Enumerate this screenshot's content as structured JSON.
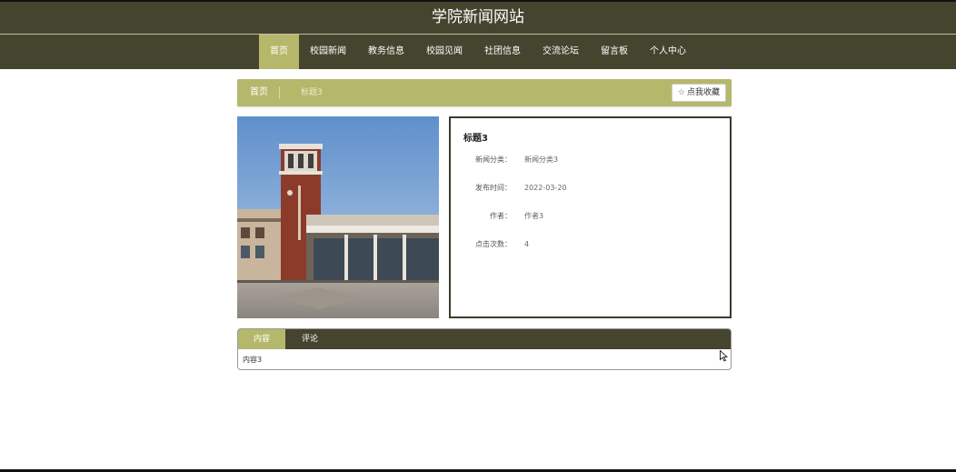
{
  "header": {
    "title": "学院新闻网站"
  },
  "nav": {
    "items": [
      {
        "label": "首页",
        "active": true
      },
      {
        "label": "校园新闻"
      },
      {
        "label": "教务信息"
      },
      {
        "label": "校园见闻"
      },
      {
        "label": "社团信息"
      },
      {
        "label": "交流论坛"
      },
      {
        "label": "留言板"
      },
      {
        "label": "个人中心"
      }
    ]
  },
  "breadcrumb": {
    "home": "首页",
    "current": "标题3"
  },
  "favorite": {
    "label": "点我收藏",
    "icon": "star-icon"
  },
  "article": {
    "title": "标题3",
    "fields": [
      {
        "label": "新闻分类：",
        "value": "新闻分类3"
      },
      {
        "label": "发布时间：",
        "value": "2022-03-20"
      },
      {
        "label": "作者：",
        "value": "作者3"
      },
      {
        "label": "点击次数：",
        "value": "4"
      }
    ]
  },
  "tabs": {
    "items": [
      {
        "label": "内容",
        "active": true
      },
      {
        "label": "评论"
      }
    ],
    "content": "内容3"
  },
  "colors": {
    "header_bg": "#45442e",
    "accent": "#b5b86b"
  }
}
